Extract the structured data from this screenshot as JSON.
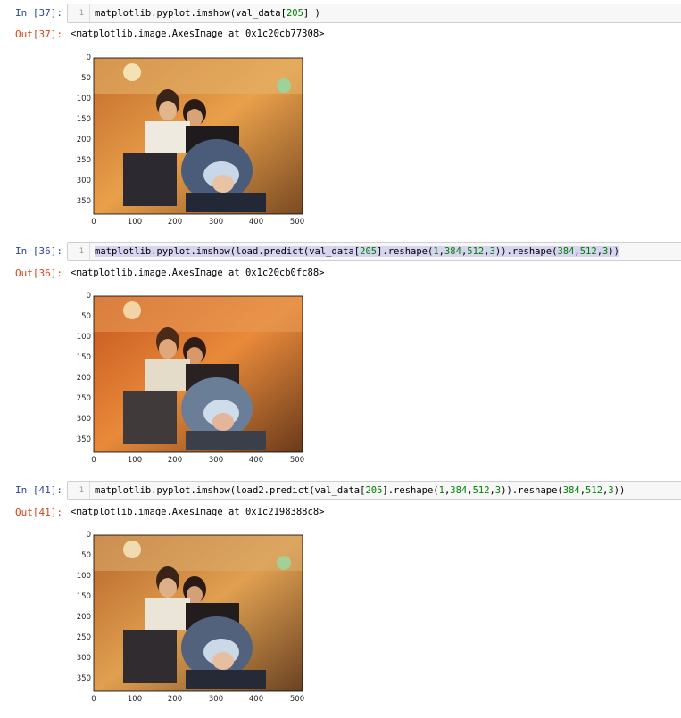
{
  "cells": [
    {
      "in_prompt": "In [37]:",
      "line_number": "1",
      "code": "matplotlib.pyplot.imshow(val_data[205] )",
      "out_prompt": "Out[37]:",
      "output_text": "<matplotlib.image.AxesImage at 0x1c20cb77308>",
      "yticks": [
        "0",
        "50",
        "100",
        "150",
        "200",
        "250",
        "300",
        "350"
      ],
      "xticks": [
        "0",
        "100",
        "200",
        "300",
        "400",
        "500"
      ],
      "image": "photo of two smiling women with a baby in a stroller in a shopping mall"
    },
    {
      "in_prompt": "In [36]:",
      "line_number": "1",
      "code": "matplotlib.pyplot.imshow(load.predict(val_data[205].reshape(1,384,512,3)).reshape(384,512,3))",
      "out_prompt": "Out[36]:",
      "output_text": "<matplotlib.image.AxesImage at 0x1c20cb0fc88>",
      "yticks": [
        "0",
        "50",
        "100",
        "150",
        "200",
        "250",
        "300",
        "350"
      ],
      "xticks": [
        "0",
        "100",
        "200",
        "300",
        "400",
        "500"
      ],
      "image": "reconstructed photo, orange-tinted and blurry"
    },
    {
      "in_prompt": "In [41]:",
      "line_number": "1",
      "code": "matplotlib.pyplot.imshow(load2.predict(val_data[205].reshape(1,384,512,3)).reshape(384,512,3))",
      "out_prompt": "Out[41]:",
      "output_text": "<matplotlib.image.AxesImage at 0x1c2198388c8>",
      "yticks": [
        "0",
        "50",
        "100",
        "150",
        "200",
        "250",
        "300",
        "350"
      ],
      "xticks": [
        "0",
        "100",
        "200",
        "300",
        "400",
        "500"
      ],
      "image": "reconstructed photo, close to original"
    }
  ],
  "colors": {
    "in_prompt": "#303f9f",
    "out_prompt": "#d84315",
    "number_literal": "#008000"
  }
}
